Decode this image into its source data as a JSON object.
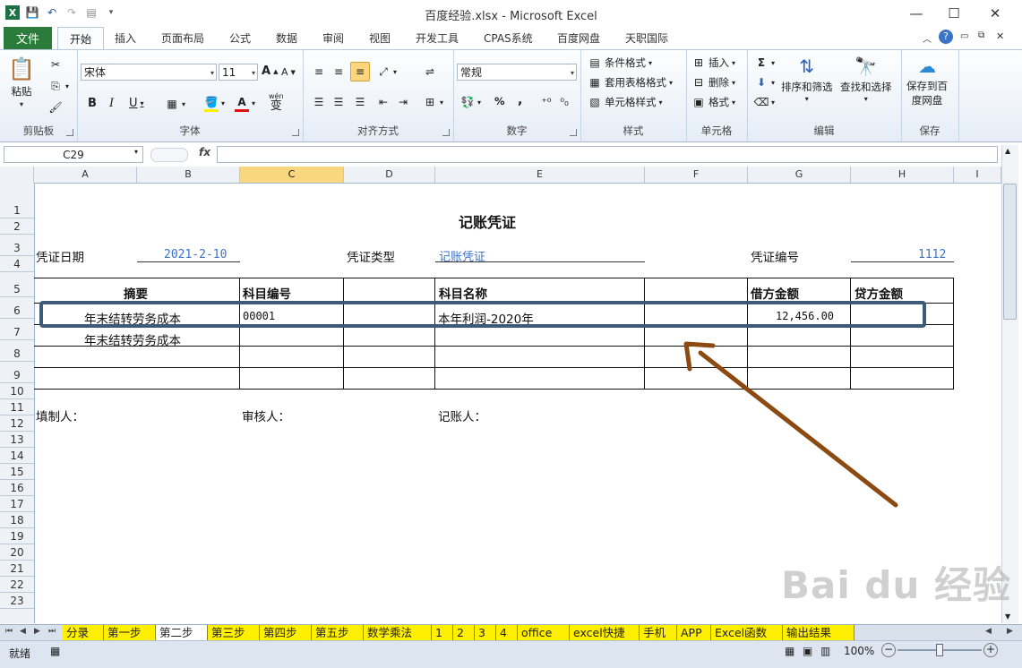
{
  "window": {
    "title": "百度经验.xlsx  -  Microsoft Excel",
    "minimize": "—",
    "maximize": "☐",
    "close": "✕"
  },
  "tabs": [
    "文件",
    "开始",
    "插入",
    "页面布局",
    "公式",
    "数据",
    "审阅",
    "视图",
    "开发工具",
    "CPAS系统",
    "百度网盘",
    "天职国际"
  ],
  "ribbon": {
    "clipboard": {
      "label": "剪贴板",
      "paste": "粘贴"
    },
    "font": {
      "label": "字体",
      "name": "宋体",
      "size": "11",
      "bold": "B",
      "italic": "I",
      "underline": "U",
      "grow": "A",
      "shrink": "A",
      "wen": "wén",
      "wen_char": "变",
      "color_a": "A"
    },
    "align": {
      "label": "对齐方式"
    },
    "number": {
      "label": "数字",
      "format": "常规",
      "percent": "%",
      "comma": ","
    },
    "styles": {
      "label": "样式",
      "conditional": "条件格式",
      "table": "套用表格格式",
      "cell": "单元格样式"
    },
    "cells": {
      "label": "单元格",
      "insert": "插入",
      "delete": "删除",
      "format": "格式"
    },
    "editing": {
      "label": "编辑",
      "sort": "排序和筛选",
      "find": "查找和选择"
    },
    "save": {
      "label": "保存",
      "save_btn_1": "保存到百",
      "save_btn_2": "度网盘"
    }
  },
  "formula_bar": {
    "name_box": "C29",
    "fx": "fx",
    "value": ""
  },
  "columns": [
    "A",
    "B",
    "C",
    "D",
    "E",
    "F",
    "G",
    "H",
    "I"
  ],
  "selected_column": "C",
  "rows": [
    "1",
    "2",
    "3",
    "4",
    "5",
    "6",
    "7",
    "8",
    "9",
    "10",
    "11",
    "12",
    "13",
    "14",
    "15",
    "16",
    "17",
    "18",
    "19",
    "20",
    "21",
    "22",
    "23"
  ],
  "sheet": {
    "title": "记账凭证",
    "date_label": "凭证日期",
    "date_value": "2021-2-10",
    "type_label": "凭证类型",
    "type_value": "记账凭证",
    "number_label": "凭证编号",
    "number_value": "1112",
    "headers": {
      "summary": "摘要",
      "code": "科目编号",
      "name": "科目名称",
      "debit": "借方金额",
      "credit": "贷方金额"
    },
    "row6": {
      "summary": "年末结转劳务成本",
      "code": "00001",
      "name": "本年利润-2020年",
      "debit": "12,456.00"
    },
    "row7": {
      "summary": "年末结转劳务成本"
    },
    "preparer": "填制人：",
    "reviewer": "审核人：",
    "bookkeeper": "记账人："
  },
  "sheet_tabs": [
    {
      "name": "分录",
      "color": "yellow"
    },
    {
      "name": "第一步",
      "color": "yellow"
    },
    {
      "name": "第二步",
      "color": "white"
    },
    {
      "name": "第三步",
      "color": "yellow"
    },
    {
      "name": "第四步",
      "color": "yellow"
    },
    {
      "name": "第五步",
      "color": "yellow"
    },
    {
      "name": "数学乘法",
      "color": "yellow"
    },
    {
      "name": "1",
      "color": "yellow"
    },
    {
      "name": "2",
      "color": "yellow"
    },
    {
      "name": "3",
      "color": "yellow"
    },
    {
      "name": "4",
      "color": "yellow"
    },
    {
      "name": "office",
      "color": "yellow"
    },
    {
      "name": "excel快捷",
      "color": "yellow"
    },
    {
      "name": "手机",
      "color": "yellow"
    },
    {
      "name": "APP",
      "color": "yellow"
    },
    {
      "name": "Excel函数",
      "color": "yellow"
    },
    {
      "name": "输出结果",
      "color": "yellow"
    }
  ],
  "status": {
    "ready": "就绪",
    "zoom": "100%",
    "minus": "−",
    "plus": "+"
  },
  "watermark": "Bai du 经验",
  "colors": {
    "file_tab": "#2b7b3a",
    "highlight_box": "#3d5a78",
    "arrow": "#8b4a12",
    "link_blue": "#3a72c8",
    "sheet_tab_yellow": "#ffef00"
  }
}
